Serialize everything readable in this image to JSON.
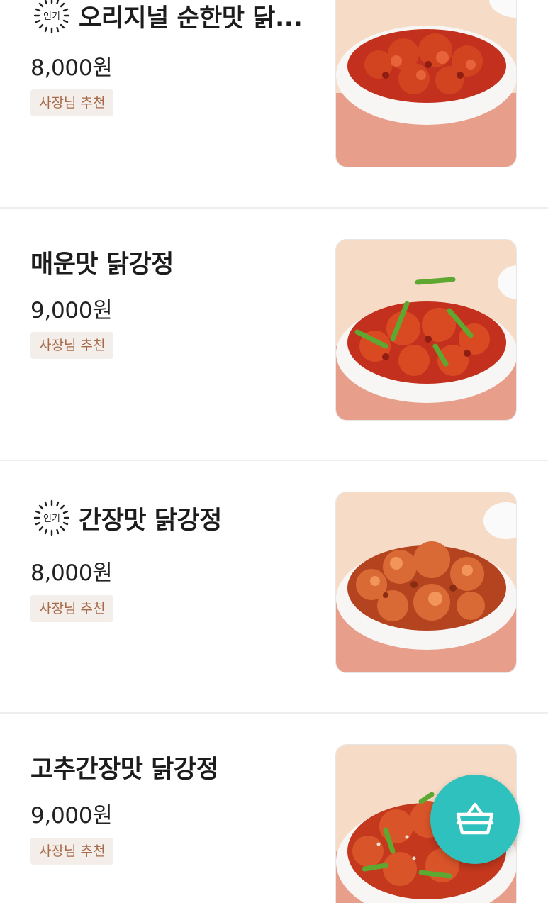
{
  "menu": {
    "items": [
      {
        "name": "오리지널 순한맛 닭...",
        "price": "8,000원",
        "tag": "사장님 추천",
        "popular": true,
        "popular_label": "인기",
        "photo_icon": "sweet-sour-chicken-photo"
      },
      {
        "name": "매운맛 닭강정",
        "price": "9,000원",
        "tag": "사장님 추천",
        "popular": false,
        "photo_icon": "spicy-chicken-photo"
      },
      {
        "name": "간장맛 닭강정",
        "price": "8,000원",
        "tag": "사장님 추천",
        "popular": true,
        "popular_label": "인기",
        "photo_icon": "soy-chicken-photo"
      },
      {
        "name": "고추간장맛 닭강정",
        "price": "9,000원",
        "tag": "사장님 추천",
        "popular": false,
        "photo_icon": "chili-soy-chicken-photo"
      }
    ]
  },
  "cart_button": {
    "icon": "basket-icon"
  },
  "colors": {
    "accent": "#2fc1bd",
    "tag_bg": "#f3eee9",
    "tag_text": "#a86a4a",
    "divider": "#eeeeee"
  }
}
